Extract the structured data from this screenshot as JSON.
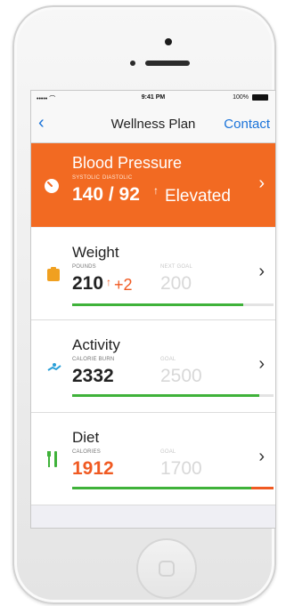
{
  "statusbar": {
    "signal": "••••• ⌒",
    "time": "9:41 PM",
    "battery": "100%"
  },
  "nav": {
    "back": "‹",
    "title": "Wellness Plan",
    "action": "Contact"
  },
  "cards": {
    "blood_pressure": {
      "title": "Blood Pressure",
      "label_systolic": "SYSTOLIC",
      "label_diastolic": "DIASTOLIC",
      "value": "140 / 92",
      "arrow": "↑",
      "status": "Elevated",
      "icon": "gauge-icon"
    },
    "weight": {
      "title": "Weight",
      "label": "POUNDS",
      "value": "210",
      "arrow": "↑",
      "delta": "+2",
      "goal_label": "NEXT GOAL",
      "goal": "200",
      "progress": 0.85,
      "icon": "scale-icon"
    },
    "activity": {
      "title": "Activity",
      "label": "CALORIE BURN",
      "value": "2332",
      "goal_label": "GOAL",
      "goal": "2500",
      "progress": 0.93,
      "icon": "runner-icon"
    },
    "diet": {
      "title": "Diet",
      "label": "CALORIES",
      "value": "1912",
      "goal_label": "GOAL",
      "goal": "1700",
      "progress": 0.89,
      "over": 0.11,
      "icon": "fork-knife-icon"
    }
  },
  "colors": {
    "accent": "#f26a22",
    "link": "#1a73d9",
    "progress": "#3fb23a",
    "over": "#f05a22"
  }
}
